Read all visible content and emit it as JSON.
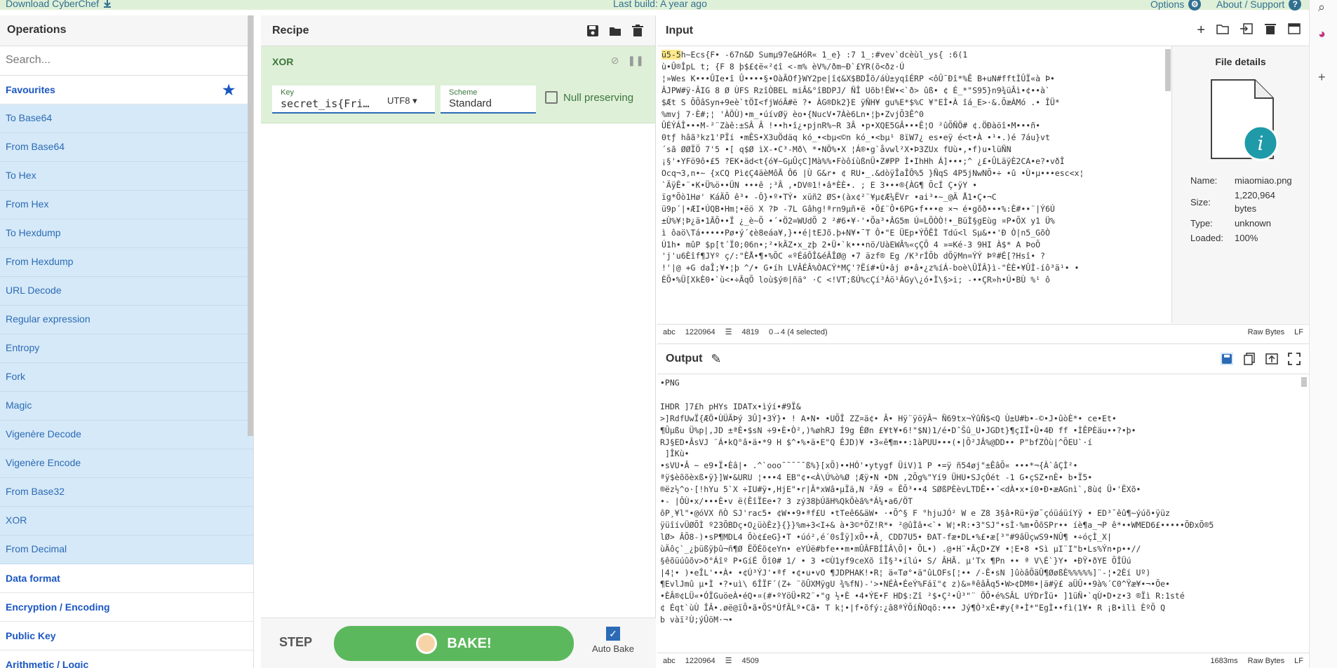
{
  "topbar": {
    "download": "Download CyberChef",
    "last_build": "Last build: A year ago",
    "options": "Options",
    "about": "About / Support"
  },
  "operations": {
    "title": "Operations",
    "search_placeholder": "Search...",
    "favourites": "Favourites",
    "items": [
      "To Base64",
      "From Base64",
      "To Hex",
      "From Hex",
      "To Hexdump",
      "From Hexdump",
      "URL Decode",
      "Regular expression",
      "Entropy",
      "Fork",
      "Magic",
      "Vigenère Decode",
      "Vigenère Encode",
      "From Base32",
      "XOR",
      "From Decimal"
    ],
    "categories": [
      "Data format",
      "Encryption / Encoding",
      "Public Key",
      "Arithmetic / Logic"
    ]
  },
  "recipe": {
    "title": "Recipe",
    "op_name": "XOR",
    "key_label": "Key",
    "key_value": "secret_is{Fri…",
    "encoding": "UTF8",
    "scheme_label": "Scheme",
    "scheme_value": "Standard",
    "null_preserving": "Null preserving",
    "step": "STEP",
    "bake": "BAKE!",
    "auto_bake": "Auto Bake",
    "auto_bake_checked": true
  },
  "input": {
    "title": "Input",
    "highlight": "ü5-5",
    "text": "h~Ecs{F• -67n&D Sumµ97e&HóR« 1_e} :7 1_:#vev`dcèùl_ys{ :6(1\nù•Û®ÎpL t; {F 8 þ$£¢ë«²¢î <-m% èV%/ðm~Ð`£YR(õ<ðz·Ú\n¦»Wes K•••ÛIe•î Û••••§•OàÃOf}WY2pe|î¢&X$BDÎõ/áÙ±yqîÉRP <ôÛ¯Ðî*%Ê B+uN#fftÌÛÏ«à Þ•\nÂJPW#ÿ·ÂIG 8 Ø ÙFS RzîÒBEL miÂ&°îBDPJ/ ÑÎ Uõb!ËW•<`ð> ûß• ¢ É_*\"S95}n9¾üÂì•¢••à`\n$Æt S ÕÕâSyn+9eè`tÖI<fjWóÂ#ë ?• ÀG®Dk2}E ÿÑH¥ gu%E*$%C ¥\"EÌ•À îá_E>·&.ÕæÀMó .• ÎÜ*\n%mvj 7·È#;¦ 'ÀÖÙ)•m_•úívØÿ èo•{NucV•7Àè6Ln•¦þ•ZvjÕ3Ê^0\nÛÉÝÁÎ•••M-²¨Zàê:±SÂ Â !••h•î¿•pjnR%~R 3Â •p•XQE5GÂ•••Ê¦O ²ûÕÑÖ# ¢.ÖÐàöî•M•••ñ•\n0tƒ hâã³kz1'PÏí •mÊS•X3uÖdäq kó_•<bµ<©n kó_•<bµ¹ 8ïW7¿ es•eÿ é<t•À •¹•.)é 7áu}vt\n´sã ØØÏÖ 7'5 •[ q$Ø ìX-•C³-Mð\\ *•NÖ%•X ¦Á®•g`åvwl²X•Þ3ZUx fUù•,•f)u•lüÑN\n¡§'•YFö9ô•£5 ?EK•äd<t{ó¥~GµÛçC]Mà%%•FòôíùßnÜ•Z#PP Ì•IhHh Á]•••;^ ¿£•ÛLäÿÈ2CA•e?•vðÎ\nOcq¬3,n•~ {xCQ Pì¢Ç4äèMôÃ Ô6 |Ù G&r• ¢ RU•_.&dòÿÎaÎÔ%5 }ÑqS 4P5jNwNÕ•÷ •û •Ù•µ•••esc<x¦\n`ÄÿÊ•¨•K•Ü%ö••ÜN •••ê ;³Â ,•DV®1!•â*ÈÈ•. ; E 3•••®{ÀG¶ ÕcÍ Ç•ÿY •\nïg*Õò1Hø' KáÄÕ ê³• -Ô}•º•TÝ• xüñ2 ØS•(àx¢²¨¥µ¢Æ¼ËVr •ai³•~_@Ä Å1•Ç•¬C\nü9p´|•ÆI•ÚQB•Hm¦•ëö X ?Þ -7L Gâhg!ªrn9µñ•ë •Ö£¨Ô•6PG•f•••e ×¬ é•gõð•••%:È#••¨|Ý6Ú\n±Ù%¥¦Þ¿ä•1ÃÕ••Ï ¿_è~Õ •´•Ö2=WUdÕ 2 ²#6•¥·'•Õa³•ÂG5m Ú=LÕÒÒ!•_BüÌ§gEùg ¤P•ÕX y1 Ü%\nì ôaö\\Tá•••••Pø•ý´¢è8eáa¥,}••é|tEJõ.þ+N¥•¯T Ô•\"E ÜEp•ÝÕÊÌ Tdú<l Sµ&••'Ð Ò|n5_GõÒ\nÚ1h• mûP $p[t´Ï0;06n•;²•kÃZ•x_zþ 2•Ü•`k•••nö/UàEWÂ%«çÇÕ 4 »=Ké-3 9HI À$* A ÞoÕ\n'j'u6Èîf¶JYº ç/:\"ÈÅ•¶•%ÕC «ºÉáÔÎ&éÂÎØ@ •7 äzf® Eg /K³rÍÕb dÕÿMn=ÝÝ Þº#É[?Hsî• ?\n!'|@ +G daÎ;¥•¦þ ^/• G•íh LVÂÉÂ%ÒACÝ*MÇ'?Ëí#•Ù•âj ø•â•¿z%íÁ-boè\\ÛÏÂ}ì-\"ÈÈ•¥ÛÌ-íô³ä¹• •\nÈÕ•%Ü[XkÈ0•`ù<•÷ÂqÕ loù$ý®|ñä° ·C <!VT;ßÚ%cÇí³Áö¹ÁGy\\¿ó•Ì\\§>i; -••ÇR»h•Ú•BÙ %¹ ô",
    "stat_length": "1220964",
    "stat_lines": "4819",
    "stat_sel": "0→4 (4 selected)",
    "raw_bytes": "Raw Bytes",
    "eol": "LF"
  },
  "file_details": {
    "title": "File details",
    "name_label": "Name:",
    "name": "miaomiao.png",
    "size_label": "Size:",
    "size": "1,220,964 bytes",
    "type_label": "Type:",
    "type": "unknown",
    "loaded_label": "Loaded:",
    "loaded": "100%"
  },
  "output": {
    "title": "Output",
    "text": "•PNG\n\nIHDR ]7£h pHYs IDATx•ìýí•#9Ï&\n>]RdfUwÏ{ÆÖ•ÙÜÃÞý 3Û]•3Ý}• ! A•N• •UÕÎ ZZ¤ä¢• Â• Hÿ¨ÿöÿÂ¬ Ñ69tx¬ÝûÑ$<Q Ù±U#b•-©•J•ûòÈ*• ce•Et•\n¶Ûµßu Ü%p|,JD ±ªÈ•$sN ÷9•È•Ò²,)%øhRJ Í9g ÉØn £¥t¥•6!\"$N)1/é•DˆŠû_U•JGDt}¶çIÏ•Ü•4Ð ff •ÌÊPÈäu••?•þ•\nRJ§ED•ÂsVJ ¨Á•kQ°â•ä•*9 H $^•%•ä•E\"Q ÉJD)¥ •3«ê¶m••:1àPUU•••(•|Õ²JÂ%@DD•• P\"bfZÒù|^ÕEU`·í\n ]ÎKù•\n•sVU•Â ~ e9•Ï•Èâ|• .^`ooo¯¯¯¯¯ß%}[xÕ)••HÓ'•ytygf ÜiV)1 P •=ÿ ñ54øj\"±ÊâÕ« •••*¬{À`âÇÌ²•\nªÿ$èõõèxß•ÿ}]W•&URU ¦•••4 EB\"¢•<À\\Ú%ò%Ø ¦Æÿ•N •DN ,2Õg%\"Yí9 ÜHU•SJçÓét -1 G•çSZ•nÈ• b•Ï5•\n®ëz½^o·[!hYu 5`X ÷IU#ÿ•,HjE\"•r|Â*xWâ•µÏä,N ²Ä9 « ÊÕ³••4 SØßPÈèvLTDÊ••´<dÀ•x•í0•Ð•æAGnì`,8ù¢ Ü•'ËXõ•\n•- |ÔÙ•x/•••È•v ë(ÊîÏEe•? 3 zý38þÚãH%QkÖèã%*Á¼•a6/ÖT\nôP¸¥l\"•@óVX ñÒ SJ'rac5• ¢W••9•ªf£U •tTeê6&äW• ·•Õ^§ F °hjuJÓ² W e Z8 3§â•Rü•ÿø¯çóüáüíYÿ • ED³¯êû¶~ýúõ•ÿüz\nÿüîívÜØÕÌ º23ÕBDç•O¿üòÈz}{}}%m+3<I+& à•3©*ÕZ!R*• ²@ûÌâ•<`• W¦•R:•3\"SJ\"•sÌ·%m•ÕõSPr•• íè¶a_¬P ê*••WMED6£•••••ÕÐxÕ®5\nlØ> ÂÕ8-)•sP¶MDL4 Õò¢£eG}•T •úó²,é´0sÎÿ]xÕ••Â¸ CDD7U5• ÐAT-fæ•DL•%£•æ[³\"#9âÜçwS9•NÛ¶ •÷óçÌ_X|\nùÄôç`_¿þüßÿþû¬ñ¶Ø ËÖÉõ¢eYn• eYÚë#bfe••m•mÛÂFBÍÌÂ\\Õ|• ÕL•) .@•H¨•ÃçD•Z¥ •¦E•8 •Sì µI¨I\"b•Ls%Ýn•p••//\n§êõüúûõv>ð°Áîº P•GíÉ Õî0# 1/ • 3 •©Ù1yf9ceXõ îÎ§³•ílú• S/ ÂHÃ. µ'Tx ¶Pn •• ª V\\É`}Y• •ÐŸ•ðYE ÕÎÜú\n|4¦• )•eÎL'••À• •¢Ú³ÝJ'•ªf •¢•u•vO ¶JDPHAK!•R¦ ä«Tø°•ä\"ûLOFs[¦•• /-Ë•sN ]ûòâÕäÛ¶ØøßÈ%%%%%]¨-¦•2Èí Uº)\n¶EvlJmû µ•Ì •?•uì\\ 6ÎÏF´(Z+ ¨õÛXMÿgU ¾%fN)-'>•NÉÀ•ÉeÝ%Fáï\"¢ z)&»ªêâÂq5•W>¢DM®•|ä#ÿ£ aÜÛ••9à%´C0^Ÿæ¥•¬•Õe•\n•ÈÂ®¢LÜ«•ÓÏGuöeÀ•éQ•¤(#•ºYöÜ•R2¨•\"g ½•È •4•ÝE•F HD$:Zî ²$•Ç²•Û³\"¨ ÖÕ•é%SÂL UÝDrÎü• ]1üÑ•`qÙ•D•z•3 ®Ïì R:1sté\n¢ Éqt`ùÙ ÎÂ•.øë@ïÕ•ã•ÕS*ÚfÃLº•Cã• T k¦•|f•õfý:¿â8ªÝÕíÑOqõ:••• Jý¶Ò³xÉ•#y{ª•Ì*\"EgÌ••fì(1¥• R ¡B•ìlì ÈºÕ Q\nb vàï²Ù;ýÛöM·¬•",
    "stat_length": "1220964",
    "stat_lines": "4509",
    "time": "1683ms",
    "raw_bytes": "Raw Bytes",
    "eol": "LF"
  }
}
